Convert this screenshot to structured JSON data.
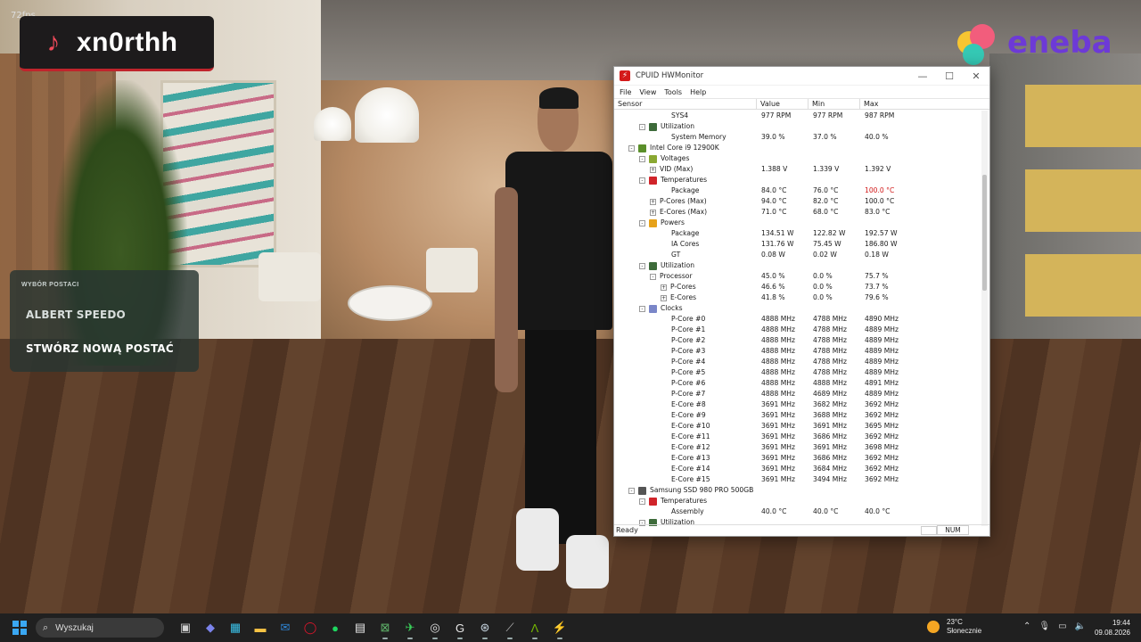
{
  "overlay": {
    "fps_text": "72fps",
    "tiktok_handle": "xn0rthh",
    "tiktok_icon": "tiktok-icon",
    "brand_logo_text": "eneba",
    "brand_colors": {
      "eneba_purple": "#6d3ad6",
      "tiktok_red": "#c0242c"
    }
  },
  "char_select": {
    "title": "WYBÓR POSTACI",
    "items": [
      {
        "label": "ALBERT SPEEDO"
      },
      {
        "label": "STWÓRZ NOWĄ POSTAĆ"
      }
    ]
  },
  "hwmonitor": {
    "title": "CPUID HWMonitor",
    "menu": [
      "File",
      "View",
      "Tools",
      "Help"
    ],
    "columns": [
      "Sensor",
      "Value",
      "Min",
      "Max"
    ],
    "rows": [
      {
        "level": 3,
        "toggle": "",
        "icon": "",
        "name": "SYS4",
        "value": "977 RPM",
        "min": "977 RPM",
        "max": "987 RPM"
      },
      {
        "level": 1,
        "toggle": "-",
        "icon": "utilization-icon",
        "name": "Utilization",
        "value": "",
        "min": "",
        "max": ""
      },
      {
        "level": 3,
        "toggle": "",
        "icon": "",
        "name": "System Memory",
        "value": "39.0 %",
        "min": "37.0 %",
        "max": "40.0 %"
      },
      {
        "level": 0,
        "toggle": "-",
        "icon": "cpu-icon",
        "name": "Intel Core i9 12900K",
        "value": "",
        "min": "",
        "max": ""
      },
      {
        "level": 1,
        "toggle": "-",
        "icon": "voltage-icon",
        "name": "Voltages",
        "value": "",
        "min": "",
        "max": ""
      },
      {
        "level": 2,
        "toggle": "+",
        "icon": "",
        "name": "VID (Max)",
        "value": "1.388 V",
        "min": "1.339 V",
        "max": "1.392 V"
      },
      {
        "level": 1,
        "toggle": "-",
        "icon": "temperature-icon",
        "name": "Temperatures",
        "value": "",
        "min": "",
        "max": ""
      },
      {
        "level": 3,
        "toggle": "",
        "icon": "",
        "name": "Package",
        "value": "84.0 °C",
        "min": "76.0 °C",
        "max": "100.0 °C",
        "hot": true
      },
      {
        "level": 2,
        "toggle": "+",
        "icon": "",
        "name": "P-Cores (Max)",
        "value": "94.0 °C",
        "min": "82.0 °C",
        "max": "100.0 °C"
      },
      {
        "level": 2,
        "toggle": "+",
        "icon": "",
        "name": "E-Cores (Max)",
        "value": "71.0 °C",
        "min": "68.0 °C",
        "max": "83.0 °C"
      },
      {
        "level": 1,
        "toggle": "-",
        "icon": "power-icon",
        "name": "Powers",
        "value": "",
        "min": "",
        "max": ""
      },
      {
        "level": 3,
        "toggle": "",
        "icon": "",
        "name": "Package",
        "value": "134.51 W",
        "min": "122.82 W",
        "max": "192.57 W"
      },
      {
        "level": 3,
        "toggle": "",
        "icon": "",
        "name": "IA Cores",
        "value": "131.76 W",
        "min": "75.45 W",
        "max": "186.80 W"
      },
      {
        "level": 3,
        "toggle": "",
        "icon": "",
        "name": "GT",
        "value": "0.08 W",
        "min": "0.02 W",
        "max": "0.18 W"
      },
      {
        "level": 1,
        "toggle": "-",
        "icon": "utilization-icon",
        "name": "Utilization",
        "value": "",
        "min": "",
        "max": ""
      },
      {
        "level": 2,
        "toggle": "-",
        "icon": "",
        "name": "Processor",
        "value": "45.0 %",
        "min": "0.0 %",
        "max": "75.7 %"
      },
      {
        "level": 4,
        "toggle": "+",
        "icon": "",
        "name": "P-Cores",
        "value": "46.6 %",
        "min": "0.0 %",
        "max": "73.7 %"
      },
      {
        "level": 4,
        "toggle": "+",
        "icon": "",
        "name": "E-Cores",
        "value": "41.8 %",
        "min": "0.0 %",
        "max": "79.6 %"
      },
      {
        "level": 1,
        "toggle": "-",
        "icon": "clock-icon",
        "name": "Clocks",
        "value": "",
        "min": "",
        "max": ""
      },
      {
        "level": 3,
        "toggle": "",
        "icon": "",
        "name": "P-Core #0",
        "value": "4888 MHz",
        "min": "4788 MHz",
        "max": "4890 MHz"
      },
      {
        "level": 3,
        "toggle": "",
        "icon": "",
        "name": "P-Core #1",
        "value": "4888 MHz",
        "min": "4788 MHz",
        "max": "4889 MHz"
      },
      {
        "level": 3,
        "toggle": "",
        "icon": "",
        "name": "P-Core #2",
        "value": "4888 MHz",
        "min": "4788 MHz",
        "max": "4889 MHz"
      },
      {
        "level": 3,
        "toggle": "",
        "icon": "",
        "name": "P-Core #3",
        "value": "4888 MHz",
        "min": "4788 MHz",
        "max": "4889 MHz"
      },
      {
        "level": 3,
        "toggle": "",
        "icon": "",
        "name": "P-Core #4",
        "value": "4888 MHz",
        "min": "4788 MHz",
        "max": "4889 MHz"
      },
      {
        "level": 3,
        "toggle": "",
        "icon": "",
        "name": "P-Core #5",
        "value": "4888 MHz",
        "min": "4788 MHz",
        "max": "4889 MHz"
      },
      {
        "level": 3,
        "toggle": "",
        "icon": "",
        "name": "P-Core #6",
        "value": "4888 MHz",
        "min": "4888 MHz",
        "max": "4891 MHz"
      },
      {
        "level": 3,
        "toggle": "",
        "icon": "",
        "name": "P-Core #7",
        "value": "4888 MHz",
        "min": "4689 MHz",
        "max": "4889 MHz"
      },
      {
        "level": 3,
        "toggle": "",
        "icon": "",
        "name": "E-Core #8",
        "value": "3691 MHz",
        "min": "3682 MHz",
        "max": "3692 MHz"
      },
      {
        "level": 3,
        "toggle": "",
        "icon": "",
        "name": "E-Core #9",
        "value": "3691 MHz",
        "min": "3688 MHz",
        "max": "3692 MHz"
      },
      {
        "level": 3,
        "toggle": "",
        "icon": "",
        "name": "E-Core #10",
        "value": "3691 MHz",
        "min": "3691 MHz",
        "max": "3695 MHz"
      },
      {
        "level": 3,
        "toggle": "",
        "icon": "",
        "name": "E-Core #11",
        "value": "3691 MHz",
        "min": "3686 MHz",
        "max": "3692 MHz"
      },
      {
        "level": 3,
        "toggle": "",
        "icon": "",
        "name": "E-Core #12",
        "value": "3691 MHz",
        "min": "3691 MHz",
        "max": "3698 MHz"
      },
      {
        "level": 3,
        "toggle": "",
        "icon": "",
        "name": "E-Core #13",
        "value": "3691 MHz",
        "min": "3686 MHz",
        "max": "3692 MHz"
      },
      {
        "level": 3,
        "toggle": "",
        "icon": "",
        "name": "E-Core #14",
        "value": "3691 MHz",
        "min": "3684 MHz",
        "max": "3692 MHz"
      },
      {
        "level": 3,
        "toggle": "",
        "icon": "",
        "name": "E-Core #15",
        "value": "3691 MHz",
        "min": "3494 MHz",
        "max": "3692 MHz"
      },
      {
        "level": 0,
        "toggle": "-",
        "icon": "ssd-icon",
        "name": "Samsung SSD 980 PRO 500GB",
        "value": "",
        "min": "",
        "max": ""
      },
      {
        "level": 1,
        "toggle": "-",
        "icon": "temperature-icon",
        "name": "Temperatures",
        "value": "",
        "min": "",
        "max": ""
      },
      {
        "level": 3,
        "toggle": "",
        "icon": "",
        "name": "Assembly",
        "value": "40.0 °C",
        "min": "40.0 °C",
        "max": "40.0 °C"
      },
      {
        "level": 1,
        "toggle": "-",
        "icon": "utilization-icon",
        "name": "Utilization",
        "value": "",
        "min": "",
        "max": ""
      }
    ],
    "status": {
      "text": "Ready",
      "num": "NUM"
    }
  },
  "taskbar": {
    "search_placeholder": "Wyszukaj",
    "apps": [
      {
        "icon": "task-view-icon",
        "glyph": "▣",
        "color": "#cfcfcf"
      },
      {
        "icon": "teams-icon",
        "glyph": "◆",
        "color": "#7b83eb"
      },
      {
        "icon": "store-icon",
        "glyph": "▦",
        "color": "#3ac1e8"
      },
      {
        "icon": "folder-icon",
        "glyph": "▬",
        "color": "#f6c344"
      },
      {
        "icon": "outlook-icon",
        "glyph": "✉",
        "color": "#2f86d6"
      },
      {
        "icon": "opera-icon",
        "glyph": "◯",
        "color": "#e3152b"
      },
      {
        "icon": "spotify-icon",
        "glyph": "●",
        "color": "#1ed760"
      },
      {
        "icon": "notepad-icon",
        "glyph": "▤",
        "color": "#e8e8e8"
      },
      {
        "icon": "xbox-icon",
        "glyph": "⊠",
        "color": "#5fb36a"
      },
      {
        "icon": "app-green-icon",
        "glyph": "✈",
        "color": "#3ad05a"
      },
      {
        "icon": "chrome-icon",
        "glyph": "◎",
        "color": "#e0e0e0"
      },
      {
        "icon": "logitech-icon",
        "glyph": "G",
        "color": "#e8e8e8"
      },
      {
        "icon": "steam-icon",
        "glyph": "⊛",
        "color": "#c7d5e0"
      },
      {
        "icon": "app-tool-icon",
        "glyph": "⟋",
        "color": "#b8b8b8"
      },
      {
        "icon": "nvidia-icon",
        "glyph": "Λ",
        "color": "#76b900"
      },
      {
        "icon": "hwmonitor-icon",
        "glyph": "⚡",
        "color": "#e0241f"
      }
    ],
    "weather": {
      "temp": "23°C",
      "desc": "Słonecznie"
    },
    "tray": [
      "chevron-up-icon",
      "mic-icon",
      "network-icon",
      "volume-icon"
    ],
    "tray_glyphs": [
      "⌃",
      "🎙",
      "▭",
      "🔈"
    ],
    "time": "19:44",
    "date": "09.08.2026"
  }
}
